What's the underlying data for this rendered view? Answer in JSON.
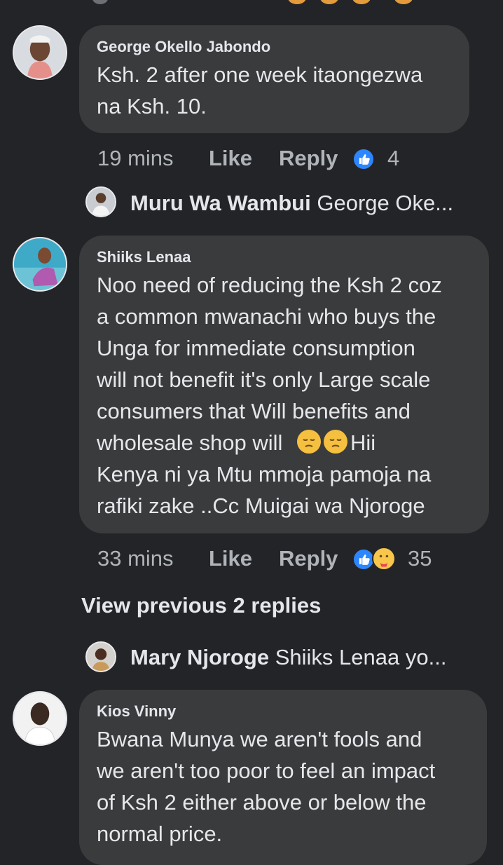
{
  "comments": [
    {
      "author": "George Okello Jabondo",
      "text_lines": [
        "Ksh. 2 after one week itaongezwa",
        "na Ksh. 10."
      ],
      "time": "19 mins",
      "like_label": "Like",
      "reply_label": "Reply",
      "reaction_count": "4",
      "reply_preview": {
        "name": "Muru Wa Wambui",
        "snippet": "George Oke..."
      }
    },
    {
      "author": "Shiiks Lenaa",
      "text_lines": [
        "Noo need of reducing the Ksh 2 coz",
        "a common mwanachi who buys the",
        "Unga for immediate consumption",
        "will not benefit it's only Large scale",
        "consumers that Will benefits and"
      ],
      "emoji_line_prefix": "wholesale shop will ",
      "emoji_line_suffix": "Hii",
      "text_lines_after": [
        "Kenya ni ya Mtu mmoja pamoja na",
        "rafiki zake ..Cc Muigai wa Njoroge"
      ],
      "time": "33 mins",
      "like_label": "Like",
      "reply_label": "Reply",
      "reaction_count": "35",
      "view_previous": "View previous 2 replies",
      "reply_preview": {
        "name": "Mary Njoroge",
        "snippet": "Shiiks Lenaa yo..."
      }
    },
    {
      "author": "Kios Vinny",
      "text_lines": [
        "Bwana Munya we aren't fools and",
        "we aren't too poor to feel an impact",
        "of Ksh 2 either above or below the",
        "normal price."
      ]
    }
  ],
  "icons": {
    "like_reaction": "thumbs-up-icon",
    "care_reaction": "care-icon",
    "pensive_emoji": "pensive-face-icon"
  },
  "colors": {
    "background": "#222427",
    "bubble": "#3a3b3c",
    "like_blue": "#2d86ff",
    "meta_text": "#b0b3b8"
  }
}
